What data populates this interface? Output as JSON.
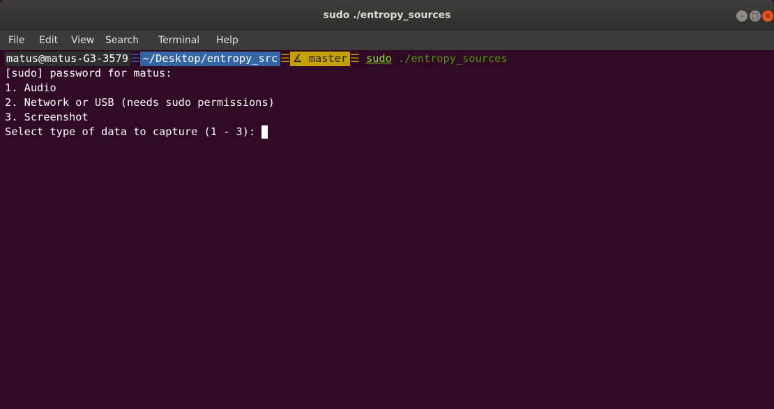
{
  "window": {
    "title": "sudo ./entropy_sources",
    "buttons": {
      "minimize": "–",
      "maximize": "□",
      "close": "×"
    }
  },
  "menu": {
    "items": [
      "File",
      "Edit",
      "View",
      "Search",
      "Terminal",
      "Help"
    ]
  },
  "prompt": {
    "user_host": "matus@matus-G3-3579",
    "separator": "☰",
    "path": "~/Desktop/entropy_src",
    "git_icon": "∡",
    "branch": "master",
    "command": "sudo",
    "args": "./entropy_sources"
  },
  "output": {
    "lines": [
      "[sudo] password for matus:",
      "1. Audio",
      "2. Network or USB (needs sudo permissions)",
      "3. Screenshot"
    ],
    "input_prompt": "Select type of data to capture (1 - 3): "
  },
  "colors": {
    "terminal_bg": "#300a24",
    "path_bg": "#3465a4",
    "git_bg": "#c4a000",
    "sudo_color": "#8ae234"
  }
}
